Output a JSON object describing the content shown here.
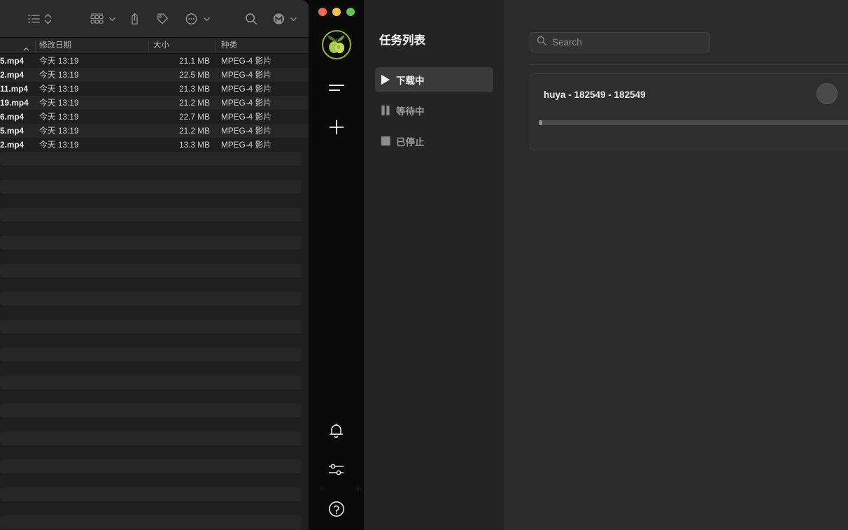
{
  "finder": {
    "toolbar": {
      "list_view_icon": "list-view-icon",
      "sort_icon": "sort-updown-icon",
      "group_icon": "group-grid-icon",
      "group_chevron_icon": "chevron-down-icon",
      "share_icon": "share-icon",
      "tag_icon": "tag-icon",
      "more_icon": "more-ellipsis-icon",
      "more_chevron_icon": "chevron-down-icon",
      "search_icon": "search-icon",
      "account_icon": "account-avatar-icon",
      "account_chevron_icon": "chevron-down-icon"
    },
    "columns": [
      {
        "label": "",
        "key": "name"
      },
      {
        "label": "修改日期",
        "key": "date"
      },
      {
        "label": "大小",
        "key": "size"
      },
      {
        "label": "种类",
        "key": "kind"
      }
    ],
    "sort_indicator": "sort-ascending-caret",
    "rows": [
      {
        "name": "5.mp4",
        "date": "今天 13:19",
        "size": "21.1 MB",
        "kind": "MPEG-4 影片"
      },
      {
        "name": "2.mp4",
        "date": "今天 13:19",
        "size": "22.5 MB",
        "kind": "MPEG-4 影片"
      },
      {
        "name": "11.mp4",
        "date": "今天 13:19",
        "size": "21.3 MB",
        "kind": "MPEG-4 影片"
      },
      {
        "name": "19.mp4",
        "date": "今天 13:19",
        "size": "21.2 MB",
        "kind": "MPEG-4 影片"
      },
      {
        "name": "6.mp4",
        "date": "今天 13:19",
        "size": "22.7 MB",
        "kind": "MPEG-4 影片"
      },
      {
        "name": "5.mp4",
        "date": "今天 13:19",
        "size": "21.2 MB",
        "kind": "MPEG-4 影片"
      },
      {
        "name": "2.mp4",
        "date": "今天 13:19",
        "size": "13.3 MB",
        "kind": "MPEG-4 影片"
      }
    ],
    "empty_row_count": 27
  },
  "app": {
    "window_controls": {
      "close": "close-traffic-light",
      "minimize": "minimize-traffic-light",
      "zoom": "zoom-traffic-light"
    },
    "logo": "olive-app-logo",
    "rail": [
      {
        "name": "menu-icon",
        "icon": "hamburger-menu-icon"
      },
      {
        "name": "add-icon",
        "icon": "plus-add-task-icon"
      },
      {
        "name": "bell-icon",
        "icon": "notification-bell-icon"
      },
      {
        "name": "settings-icon",
        "icon": "sliders-settings-icon"
      },
      {
        "name": "help-icon",
        "icon": "question-help-icon"
      }
    ],
    "ghost_marks": {
      "close": "×",
      "add": "+"
    },
    "tasklist": {
      "title": "任务列表",
      "items": [
        {
          "label": "下载中",
          "icon": "play-triangle-icon",
          "active": true
        },
        {
          "label": "等待中",
          "icon": "pause-bars-icon",
          "active": false
        },
        {
          "label": "已停止",
          "icon": "stop-square-icon",
          "active": false
        }
      ]
    },
    "search": {
      "placeholder": "Search",
      "value": "",
      "icon": "search-icon"
    },
    "tasks": [
      {
        "title": "huya - 182549 - 182549",
        "progress_percent": 1,
        "action_button": "task-action-circle-button"
      }
    ]
  },
  "colors": {
    "app_bg": "#2b2b2b",
    "rail_bg": "#0a0a0a",
    "tasklist_bg": "#242424",
    "finder_bg": "#1e1e1e",
    "accent_green": "#9bc544",
    "active_item_bg": "#3a3a3a"
  }
}
